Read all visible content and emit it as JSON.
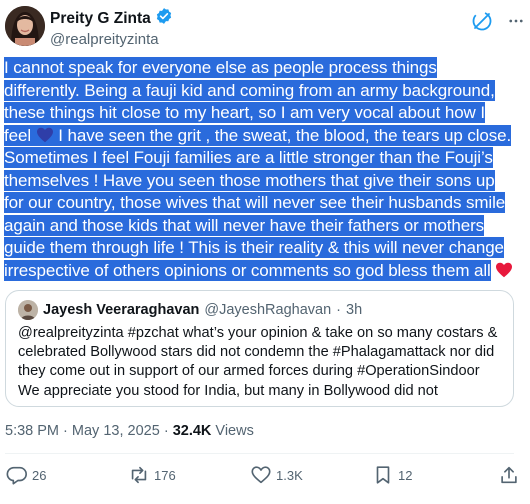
{
  "author": {
    "name": "Preity G Zinta",
    "handle": "@realpreityzinta",
    "verified_color": "#1d9bf0"
  },
  "tweet": {
    "text_parts": [
      "I cannot speak for everyone else as people process things differently. Being a fauji kid and coming from an army background, these things hit close to my heart, so I am very vocal about how I feel ",
      " I have seen the grit , the sweat, the blood, the tears up close. Sometimes I feel Fouji families are a little stronger than the Fouji’s themselves ! Have you seen those mothers that give their sons up for our country, those wives that will never see their husbands smile again and those kids that will never have their fathers or mothers guide them through life ! This is their reality & this will never change irrespective of others opinions or comments so god bless them all"
    ],
    "emoji_icons": [
      "blue-heart-icon",
      "red-heart-icon"
    ],
    "highlight_color": "#2a6bdc"
  },
  "quote": {
    "name": "Jayesh Veeraraghavan",
    "handle": "@JayeshRaghavan",
    "separator": "·",
    "time": "3h",
    "text": "@realpreityzinta #pzchat what’s your opinion & take on so many costars & celebrated Bollywood stars did not condemn the #Phalagamattack nor did they come out in support of our armed forces during #OperationSindoor\nWe appreciate you stood for India, but many in Bollywood did not"
  },
  "meta": {
    "time": "5:38 PM",
    "separator": "·",
    "date": "May 13, 2025",
    "views_count": "32.4K",
    "views_label": "Views"
  },
  "actions": {
    "replies": "26",
    "reposts": "176",
    "likes": "1.3K",
    "bookmarks": "12"
  },
  "colors": {
    "grok_accent": "#1d9bf0",
    "secondary_text": "#536471",
    "primary_text": "#0f1419"
  }
}
